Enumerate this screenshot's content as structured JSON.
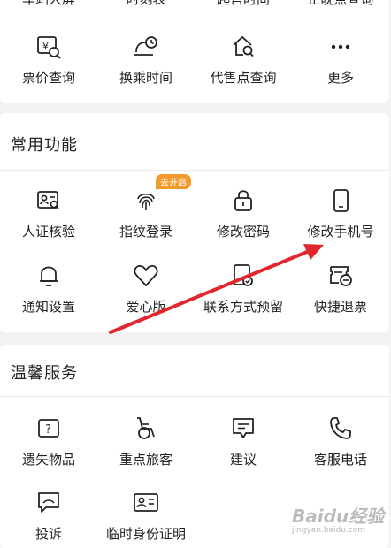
{
  "top_cut_labels": [
    "车站大屏",
    "时刻表",
    "起售时间",
    "正晚点查询"
  ],
  "top_row": [
    {
      "label": "票价查询",
      "icon": "fare-search-icon"
    },
    {
      "label": "换乘时间",
      "icon": "transfer-clock-icon"
    },
    {
      "label": "代售点查询",
      "icon": "agency-search-icon"
    },
    {
      "label": "更多",
      "icon": "more-icon"
    }
  ],
  "common": {
    "title": "常用功能",
    "badge": "去开启",
    "items": [
      {
        "label": "人证核验",
        "icon": "id-card-verify-icon"
      },
      {
        "label": "指纹登录",
        "icon": "fingerprint-icon"
      },
      {
        "label": "修改密码",
        "icon": "lock-icon"
      },
      {
        "label": "修改手机号",
        "icon": "phone-icon"
      },
      {
        "label": "通知设置",
        "icon": "bell-icon"
      },
      {
        "label": "爱心版",
        "icon": "heart-icon"
      },
      {
        "label": "联系方式预留",
        "icon": "contact-reserve-icon"
      },
      {
        "label": "快捷退票",
        "icon": "quick-refund-icon"
      }
    ]
  },
  "warm": {
    "title": "温馨服务",
    "items": [
      {
        "label": "遗失物品",
        "icon": "lost-item-icon"
      },
      {
        "label": "重点旅客",
        "icon": "wheelchair-icon"
      },
      {
        "label": "建议",
        "icon": "feedback-icon"
      },
      {
        "label": "客服电话",
        "icon": "service-phone-icon"
      },
      {
        "label": "投诉",
        "icon": "complaint-icon"
      },
      {
        "label": "临时身份证明",
        "icon": "temp-id-icon"
      }
    ]
  },
  "watermark": {
    "main": "Baidu经验",
    "sub": "jingyan.baidu.com"
  },
  "colors": {
    "accent": "#f29a2e",
    "arrow": "#e0262f"
  }
}
